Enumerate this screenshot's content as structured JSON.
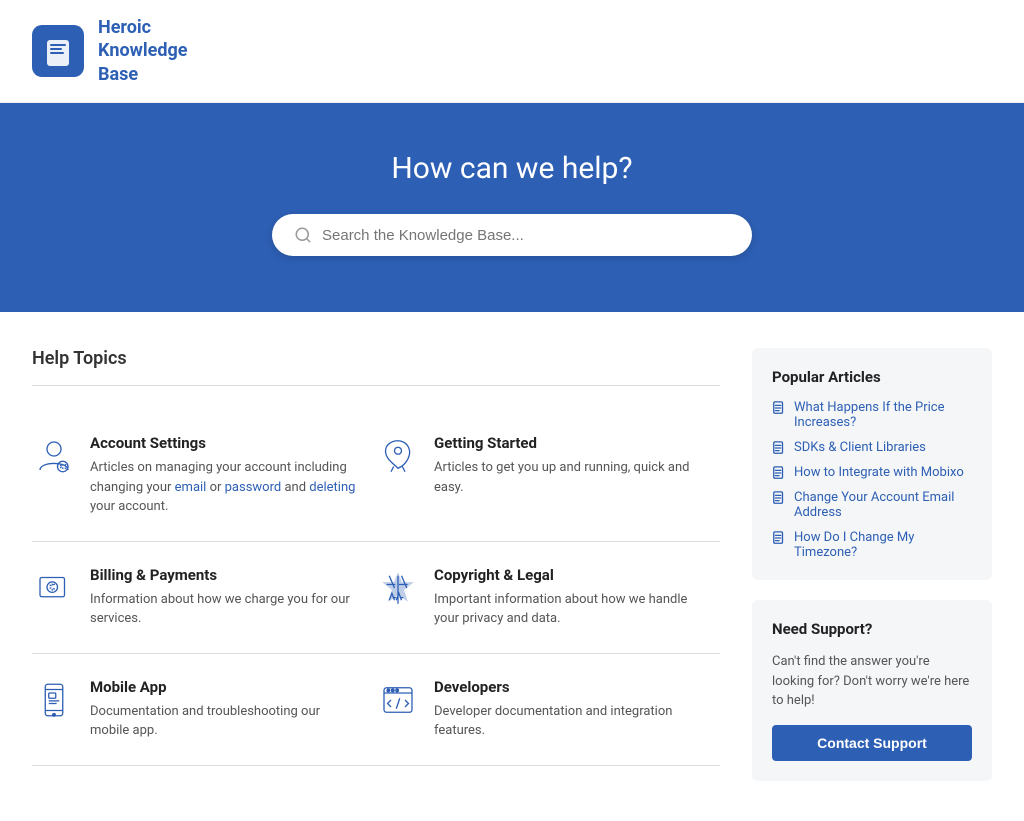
{
  "header": {
    "logo_alt": "Heroic Knowledge Base Logo",
    "title_line1": "Heroic",
    "title_line2": "Knowledge",
    "title_line3": "Base"
  },
  "hero": {
    "title": "How can we help?",
    "search_placeholder": "Search the Knowledge Base..."
  },
  "main": {
    "section_title": "Help Topics",
    "topics": [
      {
        "id": "account-settings",
        "title": "Account Settings",
        "description": "Articles on managing your account including changing your email or password and deleting your account.",
        "icon": "account"
      },
      {
        "id": "getting-started",
        "title": "Getting Started",
        "description": "Articles to get you up and running, quick and easy.",
        "icon": "rocket"
      },
      {
        "id": "billing-payments",
        "title": "Billing & Payments",
        "description": "Information about how we charge you for our services.",
        "icon": "billing"
      },
      {
        "id": "copyright-legal",
        "title": "Copyright & Legal",
        "description": "Important information about how we handle your privacy and data.",
        "icon": "legal"
      },
      {
        "id": "mobile-app",
        "title": "Mobile App",
        "description": "Documentation and troubleshooting our mobile app.",
        "icon": "mobile"
      },
      {
        "id": "developers",
        "title": "Developers",
        "description": "Developer documentation and integration features.",
        "icon": "developers"
      }
    ]
  },
  "sidebar": {
    "popular_title": "Popular Articles",
    "articles": [
      "What Happens If the Price Increases?",
      "SDKs & Client Libraries",
      "How to Integrate with Mobixo",
      "Change Your Account Email Address",
      "How Do I Change My Timezone?"
    ],
    "support_title": "Need Support?",
    "support_text": "Can't find the answer you're looking for? Don't worry we're here to help!",
    "contact_label": "Contact Support"
  }
}
